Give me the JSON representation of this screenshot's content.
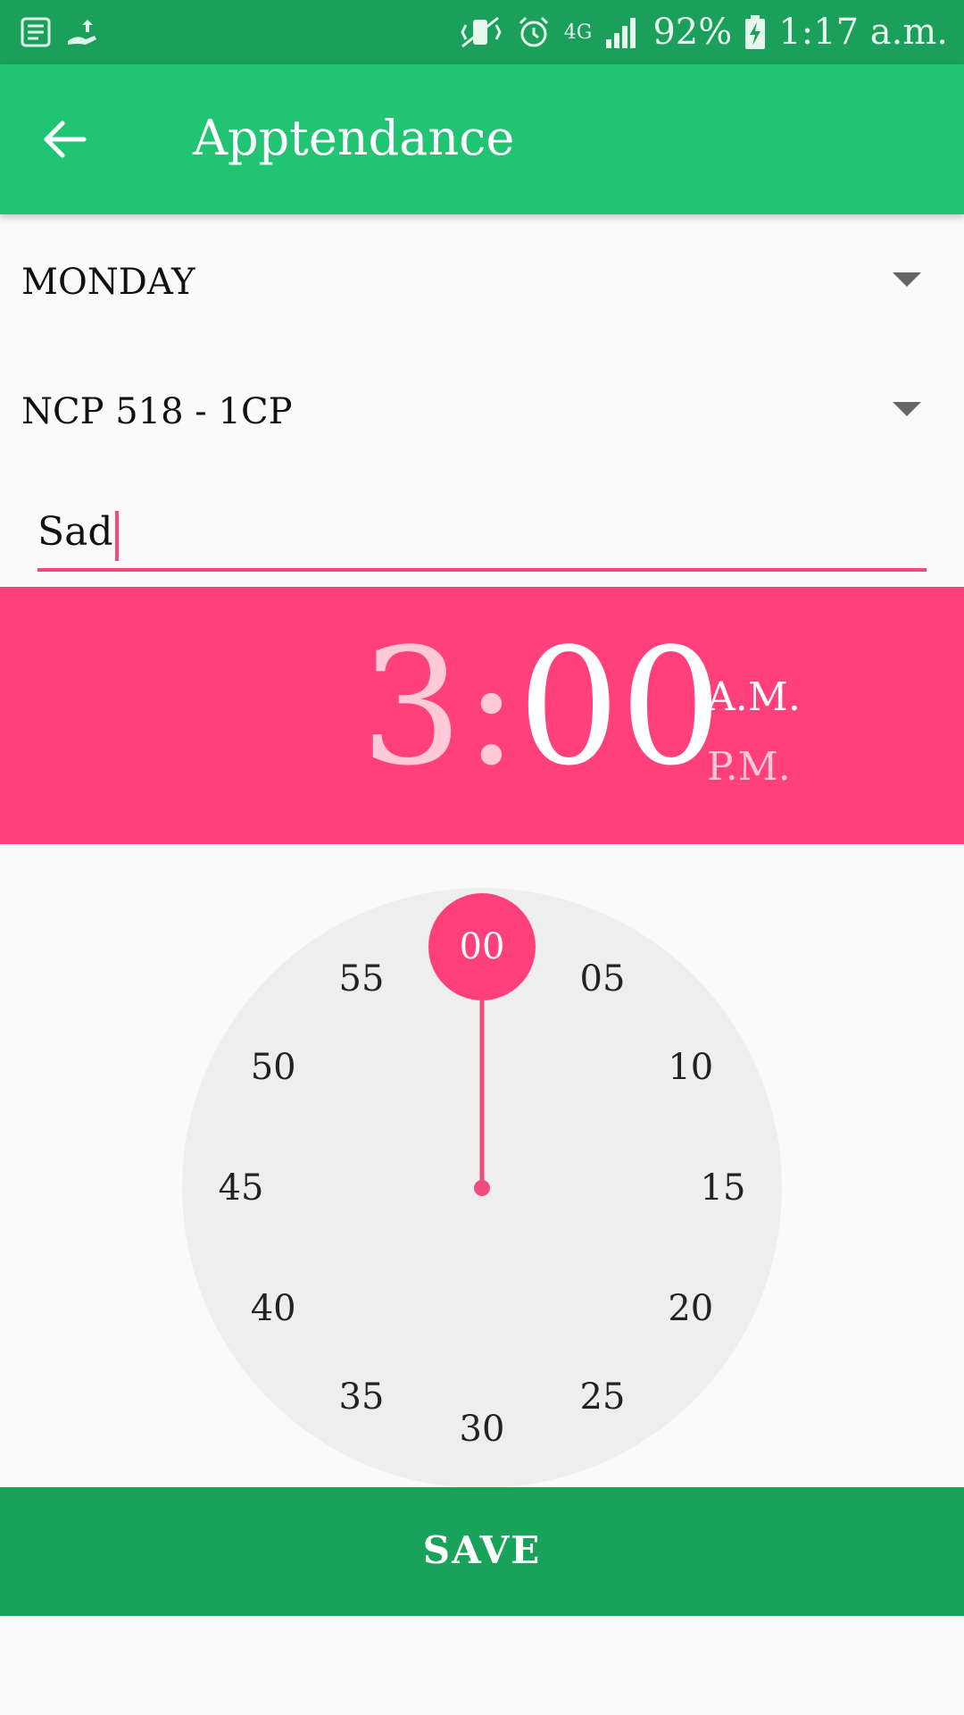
{
  "status_bar": {
    "battery": "92%",
    "time": "1:17 a.m.",
    "network": "4G",
    "icons": [
      "notes-icon",
      "upload-icon",
      "vibrate-icon",
      "alarm-icon",
      "signal-icon",
      "battery-charging-icon"
    ]
  },
  "app_bar": {
    "title": "Apptendance",
    "back_icon": "arrow-left-icon"
  },
  "form": {
    "day_value": "MONDAY",
    "course_value": "NCP 518 - 1CP",
    "name_value": "Sad"
  },
  "time_picker": {
    "hour": "3",
    "separator": ":",
    "minute": "00",
    "am_label": "A.M.",
    "pm_label": "P.M.",
    "selected_period": "A.M.",
    "selected_minute": 0,
    "dial_labels": [
      "00",
      "05",
      "10",
      "15",
      "20",
      "25",
      "30",
      "35",
      "40",
      "45",
      "50",
      "55"
    ]
  },
  "actions": {
    "save_label": "SAVE"
  },
  "colors": {
    "status_bar": "#1aa05a",
    "app_bar": "#20c472",
    "accent": "#ff407a",
    "save_bar": "#19a25a",
    "dial_bg": "#eeeeee",
    "page_bg": "#fafafa"
  }
}
